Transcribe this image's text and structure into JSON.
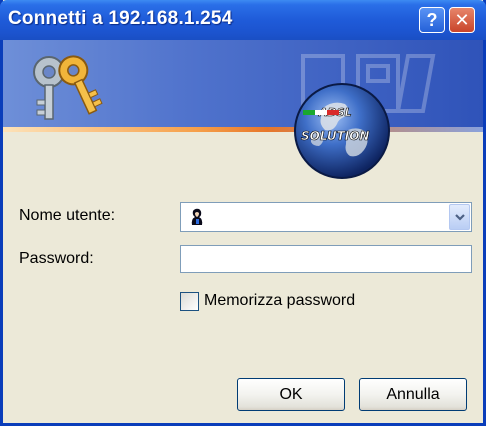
{
  "window": {
    "title": "Connetti a 192.168.1.254",
    "help_label": "?",
    "close_label": "✕"
  },
  "banner": {
    "logo_text": [
      "ADSL",
      "SOLUTION"
    ]
  },
  "form": {
    "username_label": "Nome utente:",
    "username_value": "",
    "password_label": "Password:",
    "password_value": "",
    "remember_label": "Memorizza password",
    "remember_checked": false
  },
  "buttons": {
    "ok_label": "OK",
    "cancel_label": "Annulla"
  },
  "icons": {
    "keys": "keys-icon",
    "user": "user-icon",
    "dropdown": "chevron-down-icon",
    "help": "help-icon",
    "close": "close-icon"
  },
  "colors": {
    "titlebar": "#1f5bd9",
    "close_button": "#c9442a",
    "dialog_bg": "#ece9d8",
    "input_border": "#7f9db9"
  }
}
